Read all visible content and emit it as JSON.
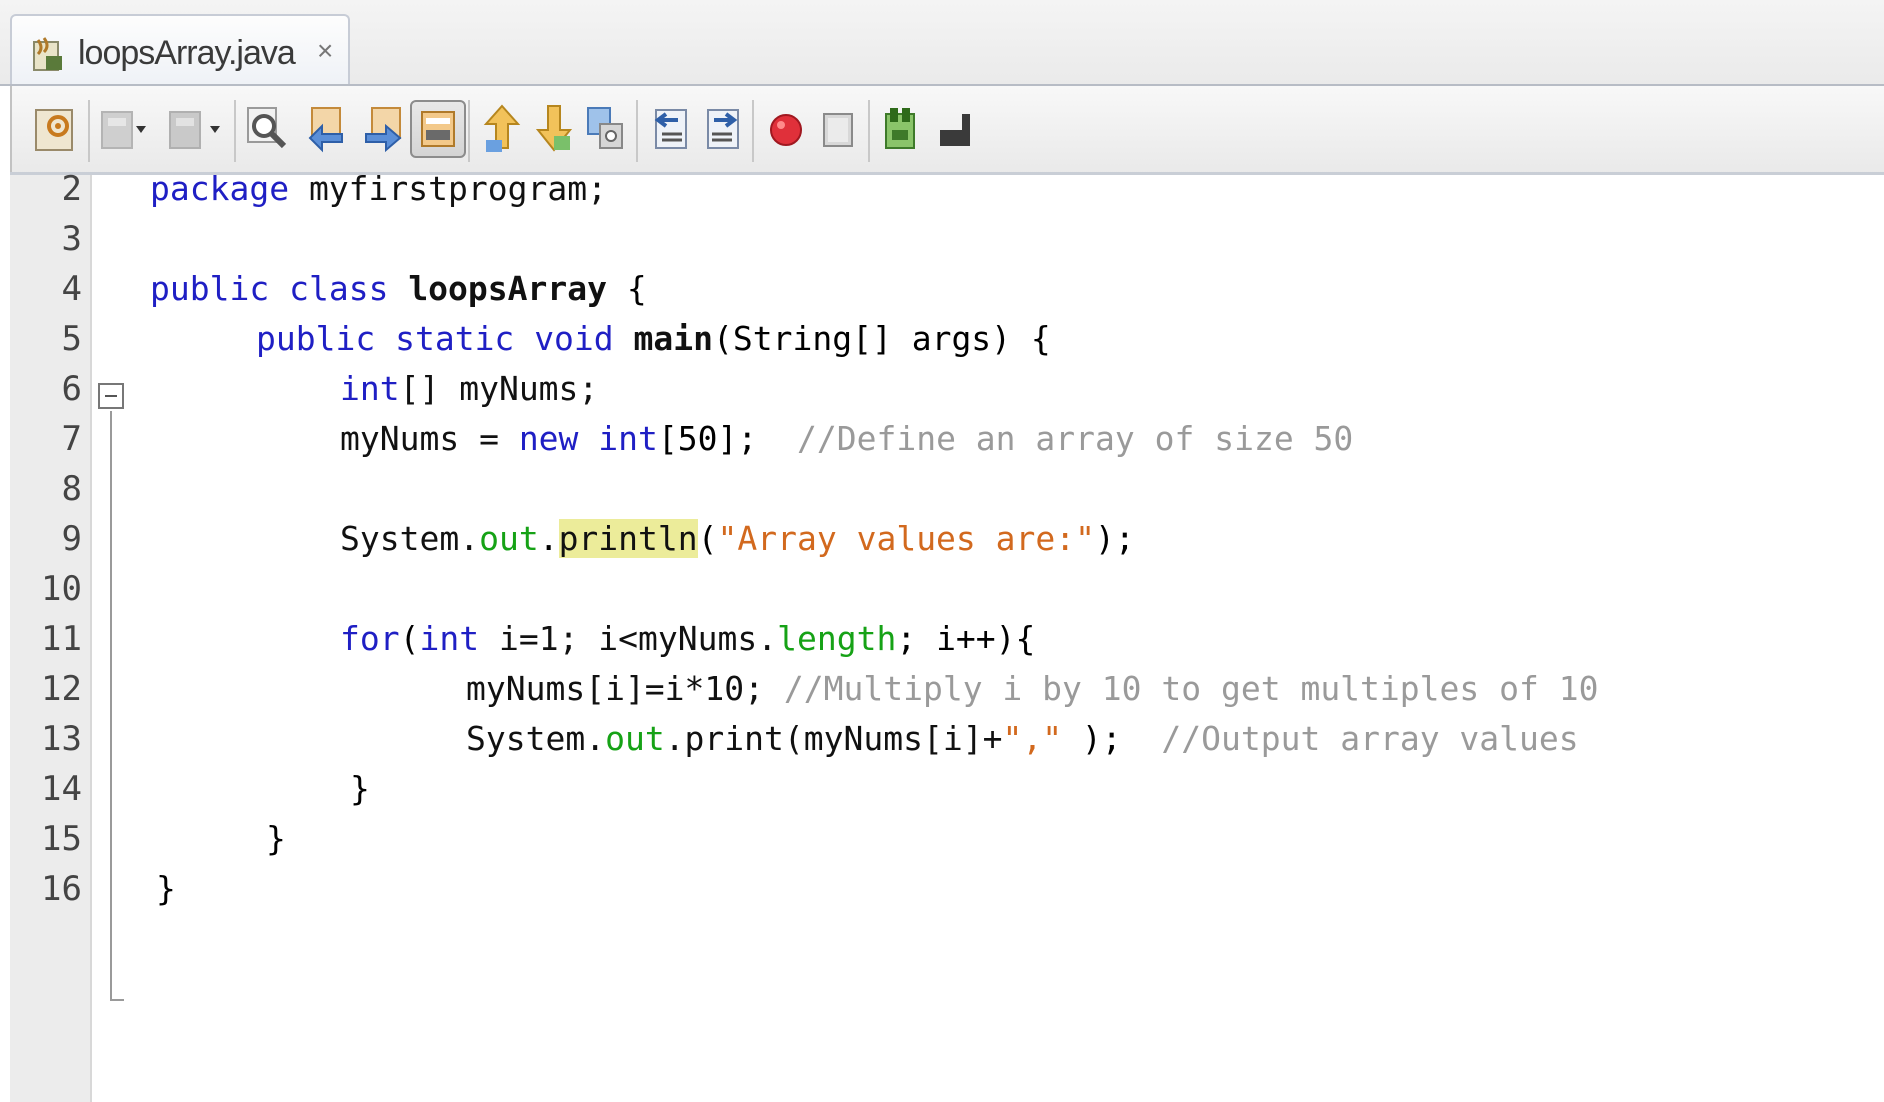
{
  "tab": {
    "filename": "loopsArray.java",
    "close_glyph": "×"
  },
  "toolbar": {
    "buttons": [
      {
        "name": "last-edit-icon"
      },
      {
        "name": "back-icon"
      },
      {
        "name": "forward-icon"
      },
      {
        "name": "find-icon"
      },
      {
        "name": "find-previous-icon"
      },
      {
        "name": "find-next-icon"
      },
      {
        "name": "toggle-highlight-icon"
      },
      {
        "name": "previous-bookmark-icon"
      },
      {
        "name": "next-bookmark-icon"
      },
      {
        "name": "toggle-bookmark-icon"
      },
      {
        "name": "shift-left-icon"
      },
      {
        "name": "shift-right-icon"
      },
      {
        "name": "start-macro-icon"
      },
      {
        "name": "stop-macro-icon"
      },
      {
        "name": "comment-icon"
      },
      {
        "name": "uncomment-icon"
      }
    ]
  },
  "editor": {
    "line_numbers": [
      "2",
      "3",
      "4",
      "5",
      "6",
      "7",
      "8",
      "9",
      "10",
      "11",
      "12",
      "13",
      "14",
      "15",
      "16"
    ],
    "code": {
      "l2": {
        "kw": "package",
        "rest": " myfirstprogram;"
      },
      "l4": {
        "kw1": "public",
        "kw2": "class",
        "name": "loopsArray",
        "brace": " {"
      },
      "l5": {
        "kw1": "public",
        "kw2": "static",
        "kw3": "void",
        "name": "main",
        "rest": "(String[] args) {"
      },
      "l6": {
        "kw": "int",
        "rest": "[] myNums;"
      },
      "l7": {
        "var": "myNums = ",
        "kw1": "new",
        "kw2": "int",
        "rest": "[50];",
        "comment": "//Define an array of size 50"
      },
      "l9": {
        "sys": "System.",
        "out": "out",
        "dot": ".",
        "method": "println",
        "open": "(",
        "str": "\"Array values are:\"",
        "close": ");"
      },
      "l11": {
        "kw1": "for",
        "open": "(",
        "kw2": "int",
        "mid": " i=1; i<myNums.",
        "field": "length",
        "end": "; i++){"
      },
      "l12": {
        "code": "myNums[i]=i*10;",
        "comment": "//Multiply i by 10 to get multiples of 10"
      },
      "l13": {
        "sys": "System.",
        "out": "out",
        "mid": ".print(myNums[i]+",
        "str": "\",\"",
        "end": " );",
        "comment": "//Output array values"
      },
      "l14": {
        "brace": "}"
      },
      "l15": {
        "brace": "}"
      },
      "l16": {
        "brace": "}"
      }
    }
  }
}
